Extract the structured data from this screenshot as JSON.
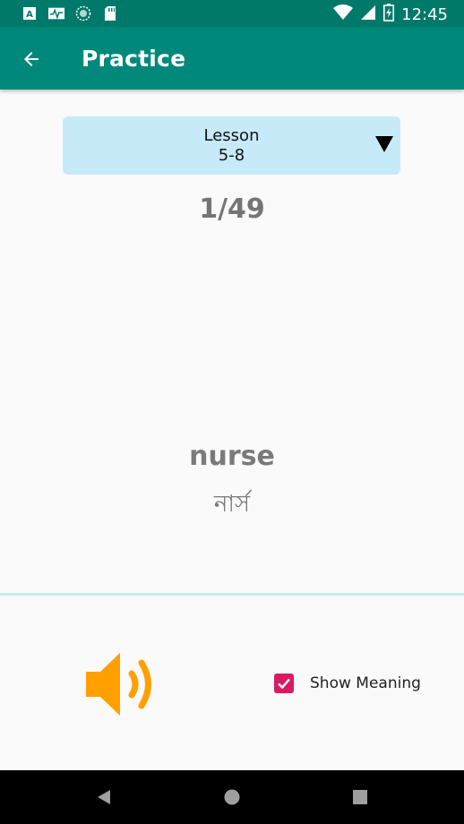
{
  "status_bar": {
    "time": "12:45",
    "left_icons": [
      "accessibility-icon",
      "activity-icon",
      "sync-icon",
      "sd-card-icon"
    ],
    "right_icons": [
      "wifi-icon",
      "cell-signal-icon",
      "battery-icon"
    ]
  },
  "app_bar": {
    "title": "Practice",
    "back_icon": "arrow-back-icon",
    "color": "#00897B"
  },
  "lesson_select": {
    "label_line1": "Lesson",
    "label_line2": "5-8",
    "background": "#C7EAF9"
  },
  "counter": "1/49",
  "card": {
    "word": "nurse",
    "meaning": "নার্স"
  },
  "controls": {
    "speaker_icon": "volume-up-icon",
    "speaker_color": "#FFA000",
    "show_meaning_label": "Show Meaning",
    "show_meaning_checked": true,
    "checkbox_color": "#D81B60"
  },
  "nav_bar": {
    "icons": [
      "back-triangle-icon",
      "home-circle-icon",
      "recents-square-icon"
    ]
  }
}
